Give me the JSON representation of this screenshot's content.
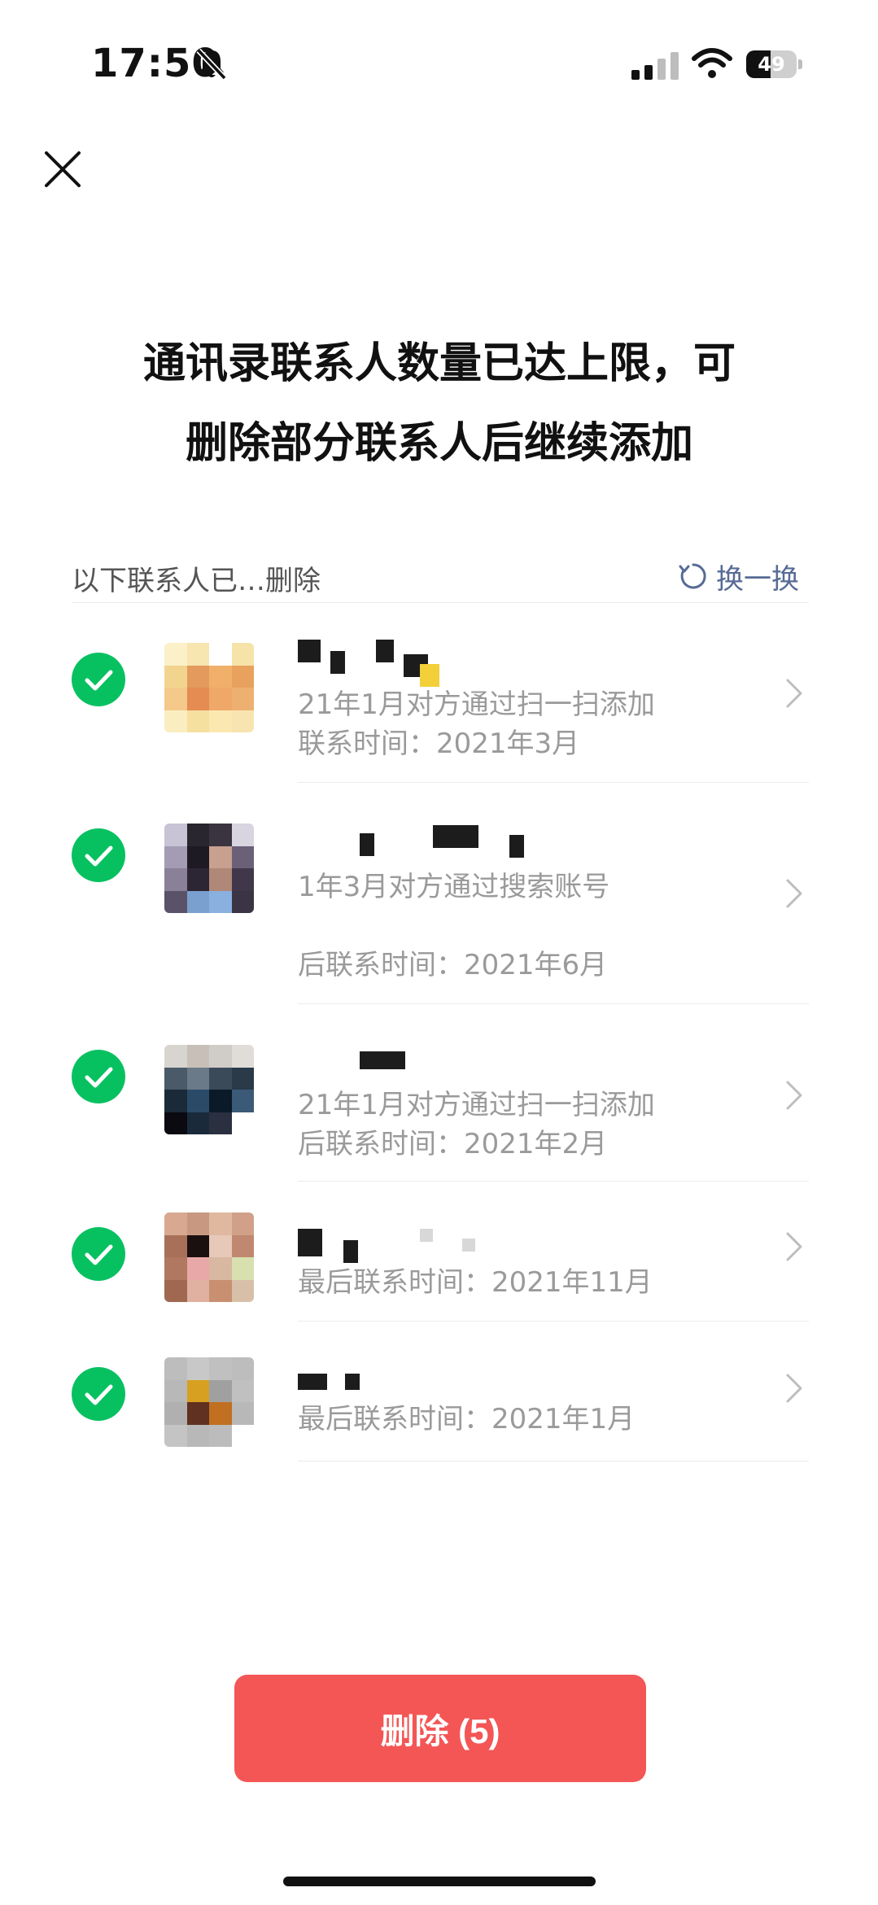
{
  "status_bar": {
    "time": "17:50",
    "battery": "49",
    "battery_level": 0.49
  },
  "dialog": {
    "title_line1": "通讯录联系人数量已达上限，可",
    "title_line2": "删除部分联系人后继续添加",
    "section_label": "以下联系人已…删除",
    "refresh_label": "换一换"
  },
  "contacts": [
    {
      "selected": true,
      "line1": "21年1月对方通过扫一扫添加",
      "line2": "联系时间：2021年3月",
      "line3": ""
    },
    {
      "selected": true,
      "line1": "1年3月对方通过搜索账号",
      "line2": "",
      "line3": "后联系时间：2021年6月"
    },
    {
      "selected": true,
      "line1": "21年1月对方通过扫一扫添加",
      "line2": "后联系时间：2021年2月",
      "line3": ""
    },
    {
      "selected": true,
      "line1": "最后联系时间：2021年11月",
      "line2": "",
      "line3": ""
    },
    {
      "selected": true,
      "line1": "最后联系时间：2021年1月",
      "line2": "",
      "line3": ""
    }
  ],
  "footer": {
    "delete_button": "删除 (5)"
  },
  "colors": {
    "accent_red": "#f35655",
    "check_green": "#07c160",
    "link_blue": "#576b95"
  },
  "icons": {
    "close": "close-icon",
    "refresh": "refresh-icon",
    "check": "check-circle-icon",
    "chevron": "chevron-right-icon"
  }
}
